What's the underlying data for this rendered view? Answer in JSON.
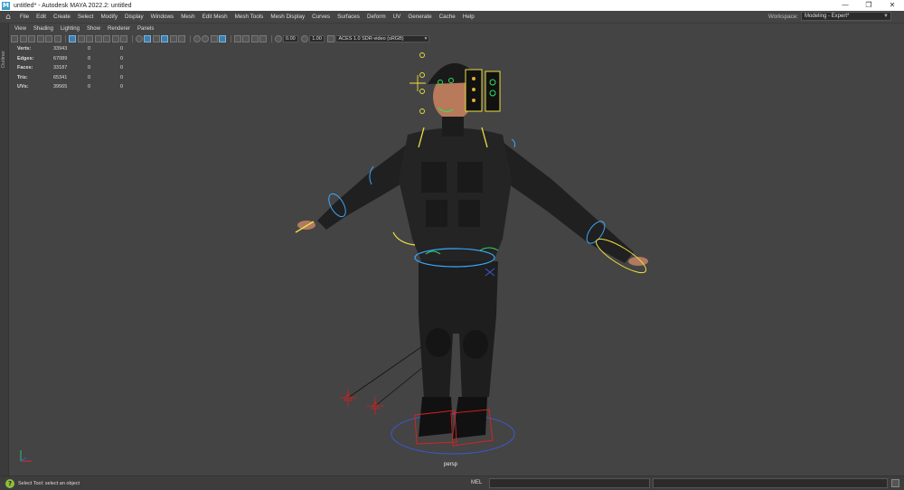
{
  "window": {
    "title": "untitled* - Autodesk MAYA 2022.2: untitled",
    "app_icon": "M",
    "minimize": "—",
    "maximize": "❐",
    "close": "✕"
  },
  "menubar": {
    "items": [
      "File",
      "Edit",
      "Create",
      "Select",
      "Modify",
      "Display",
      "Windows",
      "Mesh",
      "Edit Mesh",
      "Mesh Tools",
      "Mesh Display",
      "Curves",
      "Surfaces",
      "Deform",
      "UV",
      "Generate",
      "Cache",
      "Help"
    ],
    "workspace_label": "Workspace:",
    "workspace_value": "Modeling - Expert*"
  },
  "outliner_strip": {
    "label": "Outliner"
  },
  "panel_menu": {
    "items": [
      "View",
      "Shading",
      "Lighting",
      "Show",
      "Renderer",
      "Panels"
    ]
  },
  "panel_toolbar": {
    "exposure": "0.00",
    "gamma": "1.00",
    "color_space": "ACES 1.0 SDR-video (sRGB)"
  },
  "hud": {
    "rows": [
      {
        "label": "Verts:",
        "v1": "33943",
        "v2": "0",
        "v3": "0"
      },
      {
        "label": "Edges:",
        "v1": "67089",
        "v2": "0",
        "v3": "0"
      },
      {
        "label": "Faces:",
        "v1": "33187",
        "v2": "0",
        "v3": "0"
      },
      {
        "label": "Tris:",
        "v1": "65341",
        "v2": "0",
        "v3": "0"
      },
      {
        "label": "UVs:",
        "v1": "39565",
        "v2": "0",
        "v3": "0"
      }
    ]
  },
  "viewport": {
    "camera": "persp",
    "background_color": "#444444",
    "control_colors": {
      "yellow": "#f0e040",
      "blue": "#3aa8ff",
      "red": "#e02020",
      "green": "#30e060"
    }
  },
  "helpline": {
    "text": "Select Tool: select an object",
    "mel_label": "MEL"
  }
}
